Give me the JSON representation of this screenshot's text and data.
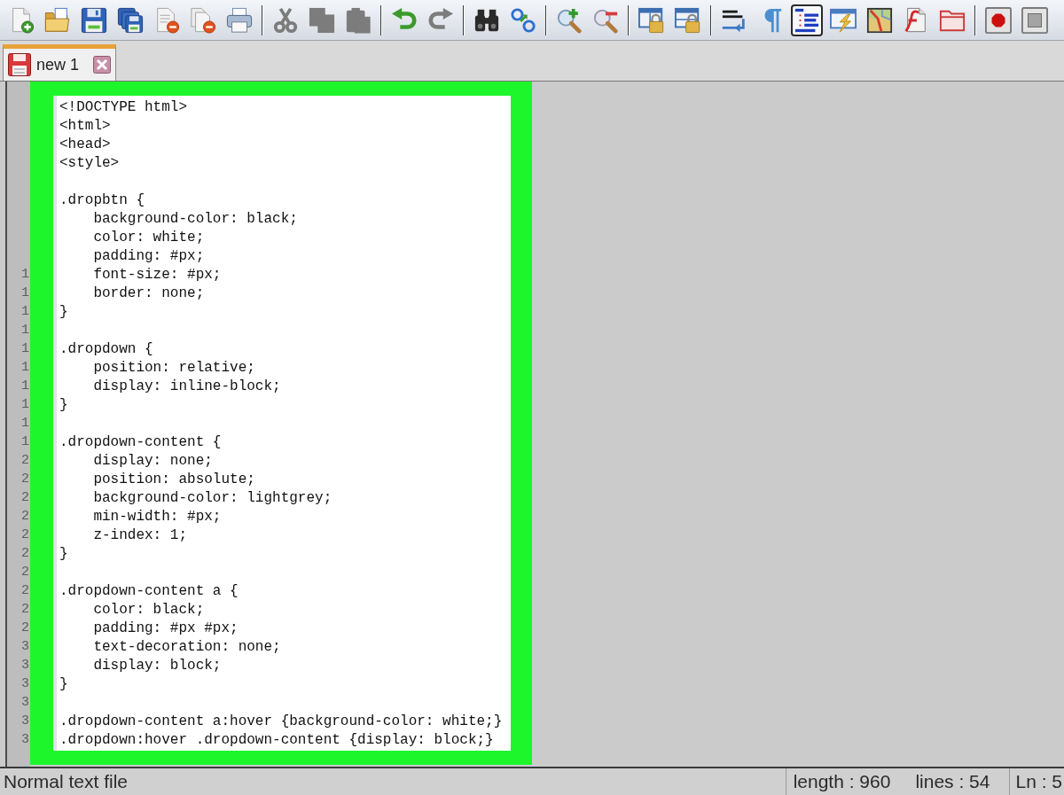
{
  "toolbar": {
    "groups": [
      [
        {
          "kind": "new-file",
          "disabled": false,
          "pressed": false
        },
        {
          "kind": "open-file",
          "disabled": false,
          "pressed": false
        },
        {
          "kind": "save",
          "disabled": false,
          "pressed": false
        },
        {
          "kind": "save-all",
          "disabled": false,
          "pressed": false
        },
        {
          "kind": "close",
          "disabled": false,
          "pressed": false
        },
        {
          "kind": "close-all",
          "disabled": false,
          "pressed": false
        },
        {
          "kind": "print",
          "disabled": false,
          "pressed": false
        }
      ],
      [
        {
          "kind": "cut",
          "disabled": true,
          "pressed": false
        },
        {
          "kind": "copy",
          "disabled": true,
          "pressed": false
        },
        {
          "kind": "paste",
          "disabled": true,
          "pressed": false
        }
      ],
      [
        {
          "kind": "undo",
          "disabled": false,
          "pressed": false
        },
        {
          "kind": "redo",
          "disabled": true,
          "pressed": false
        }
      ],
      [
        {
          "kind": "find",
          "disabled": false,
          "pressed": false
        },
        {
          "kind": "replace",
          "disabled": false,
          "pressed": false
        }
      ],
      [
        {
          "kind": "zoom-in",
          "disabled": false,
          "pressed": false
        },
        {
          "kind": "zoom-out",
          "disabled": false,
          "pressed": false
        }
      ],
      [
        {
          "kind": "sync-vertical",
          "disabled": false,
          "pressed": false
        },
        {
          "kind": "sync-horizontal",
          "disabled": false,
          "pressed": false
        }
      ],
      [
        {
          "kind": "word-wrap",
          "disabled": false,
          "pressed": false
        },
        {
          "kind": "show-symbols",
          "disabled": false,
          "pressed": false
        },
        {
          "kind": "indent-guide",
          "disabled": false,
          "pressed": true
        },
        {
          "kind": "user-language",
          "disabled": false,
          "pressed": false
        },
        {
          "kind": "document-map",
          "disabled": false,
          "pressed": false
        },
        {
          "kind": "function-list",
          "disabled": false,
          "pressed": false
        },
        {
          "kind": "folder-workspace",
          "disabled": false,
          "pressed": false
        }
      ],
      [
        {
          "kind": "record-macro",
          "disabled": false,
          "pressed": false
        },
        {
          "kind": "stop-recording",
          "disabled": false,
          "pressed": false
        }
      ]
    ]
  },
  "tabs": [
    {
      "label": "new 1",
      "selected": true,
      "saved": false
    }
  ],
  "editor": {
    "highlighted": true,
    "line_numbers": [
      "1",
      "1",
      "1",
      "1",
      "1",
      "1",
      "1",
      "1",
      "1",
      "1",
      "2",
      "2",
      "2",
      "2",
      "2",
      "2",
      "2",
      "2",
      "2",
      "2",
      "3",
      "3",
      "3",
      "3",
      "3",
      "3"
    ],
    "blocks": [
      {
        "lines": [
          {
            "text": "<!DOCTYPE html>"
          },
          {
            "text": "<html>"
          },
          {
            "text": "<head>"
          },
          {
            "text": "<style>"
          }
        ]
      },
      {
        "lines": [
          {
            "text": ".dropbtn {",
            "children": [
              {
                "text": "background-color: black;"
              },
              {
                "text": "color: white;"
              },
              {
                "text": "padding: #px;"
              },
              {
                "text": "font-size: #px;"
              },
              {
                "text": "border: none;"
              }
            ]
          },
          {
            "text": "}"
          }
        ]
      },
      {
        "lines": [
          {
            "text": ".dropdown {",
            "children": [
              {
                "text": "position: relative;"
              },
              {
                "text": "display: inline-block;"
              }
            ]
          },
          {
            "text": "}"
          }
        ]
      },
      {
        "lines": [
          {
            "text": ".dropdown-content {",
            "children": [
              {
                "text": "display: none;"
              },
              {
                "text": "position: absolute;"
              },
              {
                "text": "background-color: lightgrey;"
              },
              {
                "text": "min-width: #px;"
              },
              {
                "text": "z-index: 1;"
              }
            ]
          },
          {
            "text": "}"
          }
        ]
      },
      {
        "lines": [
          {
            "text": ".dropdown-content a {",
            "children": [
              {
                "text": "color: black;"
              },
              {
                "text": "padding: #px #px;"
              },
              {
                "text": "text-decoration: none;"
              },
              {
                "text": "display: block;"
              }
            ]
          },
          {
            "text": "}"
          }
        ]
      },
      {
        "lines": [
          {
            "text": ".dropdown-content a:hover {background-color: white;}"
          },
          {
            "text": ".dropdown:hover .dropdown-content {display: block;}"
          }
        ]
      }
    ]
  },
  "status_bar": {
    "file_type": "Normal text file",
    "length": "length : 960",
    "lines": "lines : 54",
    "position": "Ln : 5"
  }
}
